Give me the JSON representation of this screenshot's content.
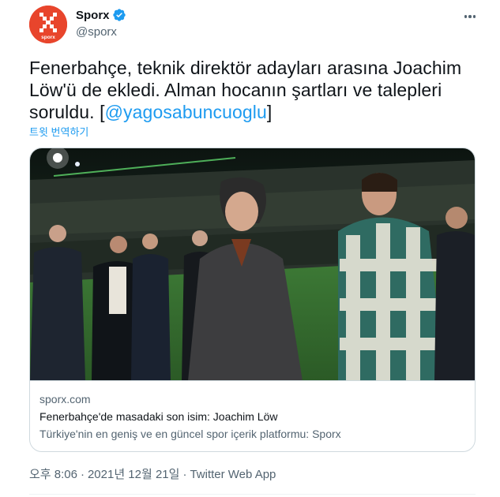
{
  "user": {
    "display_name": "Sporx",
    "handle": "@sporx",
    "avatar_brand_color": "#e8452c",
    "avatar_wordmark": "sporx",
    "verified": true
  },
  "tweet": {
    "text_line_1": "Fenerbahçe, teknik direktör adayları arasına Joachim",
    "text_line_2": "Löw'ü de ekledi. Alman hocanın şartları ve talepleri",
    "text_line_3_prefix": "soruldu. [",
    "mention": "@yagosabuncuoglu",
    "text_line_3_suffix": "]",
    "translate_label": "트윗 번역하기"
  },
  "card": {
    "domain": "sporx.com",
    "title": "Fenerbahçe'de masadaki son isim: Joachim Löw",
    "description": "Türkiye'nin en geniş ve en güncel spor içerik platformu: Sporx"
  },
  "meta": {
    "time": "오후 8:06",
    "separator": "·",
    "date": "2021년 12월 21일",
    "source": "Twitter Web App"
  },
  "colors": {
    "link": "#1d9bf0",
    "secondary_text": "#536471",
    "primary_text": "#0f1419",
    "border": "#cfd9de"
  }
}
